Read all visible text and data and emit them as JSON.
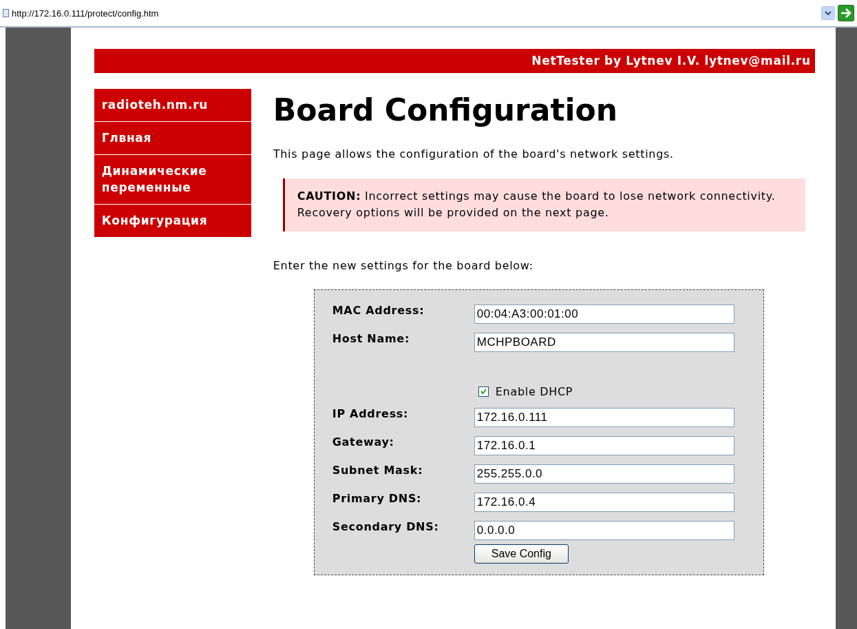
{
  "address_bar": {
    "url": "http://172.16.0.111/protect/config.htm"
  },
  "header": {
    "text": "NetTester by Lytnev I.V. lytnev@mail.ru"
  },
  "sidebar": {
    "items": [
      {
        "label": "radioteh.nm.ru"
      },
      {
        "label": "Глвная"
      },
      {
        "label": "Динамические переменные"
      },
      {
        "label": "Конфигурация"
      }
    ]
  },
  "title": "Board Configuration",
  "intro": "This page allows the configuration of the board's network settings.",
  "caution": "**CAUTION:** Incorrect settings may cause the board to lose network connectivity. Recovery options will be provided on the next page.",
  "prompt": "Enter the new settings for the board below:",
  "form": {
    "fields": [
      {
        "label": "MAC Address:",
        "value": "00:04:A3:00:01:00"
      },
      {
        "label": "Host Name:",
        "value": "MCHPBOARD"
      }
    ],
    "dhcp": {
      "label": "Enable DHCP",
      "checked": true
    },
    "network_fields": [
      {
        "label": "IP Address:",
        "value": "172.16.0.111"
      },
      {
        "label": "Gateway:",
        "value": "172.16.0.1"
      },
      {
        "label": "Subnet Mask:",
        "value": "255.255.0.0"
      },
      {
        "label": "Primary DNS:",
        "value": "172.16.0.4"
      },
      {
        "label": "Secondary DNS:",
        "value": "0.0.0.0"
      }
    ],
    "submit": "Save Config"
  }
}
